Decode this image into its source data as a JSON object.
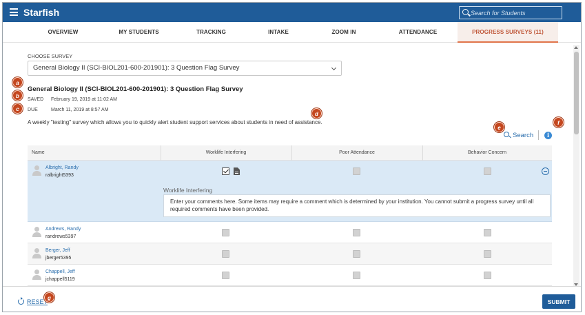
{
  "header": {
    "app_title": "Starfish",
    "search_placeholder": "Search for Students"
  },
  "tabs": [
    {
      "label": "OVERVIEW",
      "active": false
    },
    {
      "label": "MY STUDENTS",
      "active": false
    },
    {
      "label": "TRACKING",
      "active": false
    },
    {
      "label": "INTAKE",
      "active": false
    },
    {
      "label": "ZOOM IN",
      "active": false
    },
    {
      "label": "ATTENDANCE",
      "active": false
    },
    {
      "label": "PROGRESS SURVEYS (11)",
      "active": true
    }
  ],
  "survey": {
    "choose_label": "CHOOSE SURVEY",
    "selected": "General Biology II (SCI-BIOL201-600-201901): 3 Question Flag Survey",
    "title": "General Biology II (SCI-BIOL201-600-201901): 3 Question Flag Survey",
    "saved_label": "SAVED",
    "saved_value": "February 19, 2019 at 11:02 AM",
    "due_label": "DUE",
    "due_value": "March 11, 2019 at 8:57 AM",
    "description": "A weekly \"testing\" survey which allows you to quickly alert student support services about students in need of assistance."
  },
  "toolbar": {
    "search_label": "Search",
    "info_glyph": "i"
  },
  "table": {
    "columns": [
      "Name",
      "Worklife Interfering",
      "Poor Attendance",
      "Behavior Concern"
    ],
    "rows": [
      {
        "name": "Albright, Randy",
        "username": "ralbright5393",
        "worklife": true,
        "attendance": false,
        "behavior": false,
        "expanded": true
      },
      {
        "name": "Andrews, Randy",
        "username": "randrews5397",
        "worklife": false,
        "attendance": false,
        "behavior": false
      },
      {
        "name": "Berger, Jeff",
        "username": "jberger5395",
        "worklife": false,
        "attendance": false,
        "behavior": false
      },
      {
        "name": "Chappell, Jeff",
        "username": "jchappell5119",
        "worklife": false,
        "attendance": false,
        "behavior": false
      }
    ],
    "expanded_panel": {
      "label": "Worklife Interfering",
      "comment_placeholder": "Enter your comments here.  Some items may require a comment which is determined by your institution.  You cannot submit a progress survey until all required comments have been provided."
    }
  },
  "footer": {
    "reset_label": "RESET",
    "submit_label": "SUBMIT"
  },
  "callouts": [
    "a",
    "b",
    "c",
    "d",
    "e",
    "f",
    "g"
  ],
  "colors": {
    "header_bg": "#1f5c99",
    "active_tab_text": "#c0583a",
    "active_tab_bg": "#f7eeea",
    "link": "#2a6ead",
    "expanded_row_bg": "#dae9f6",
    "callout": "#c4471f"
  },
  "icons": {
    "menu": "hamburger-icon",
    "search": "search-icon",
    "info": "info-icon",
    "reset": "refresh-icon",
    "collapse": "minus-circle-icon",
    "comment": "document-icon",
    "avatar": "avatar-icon",
    "dropdown": "chevron-down-icon"
  }
}
